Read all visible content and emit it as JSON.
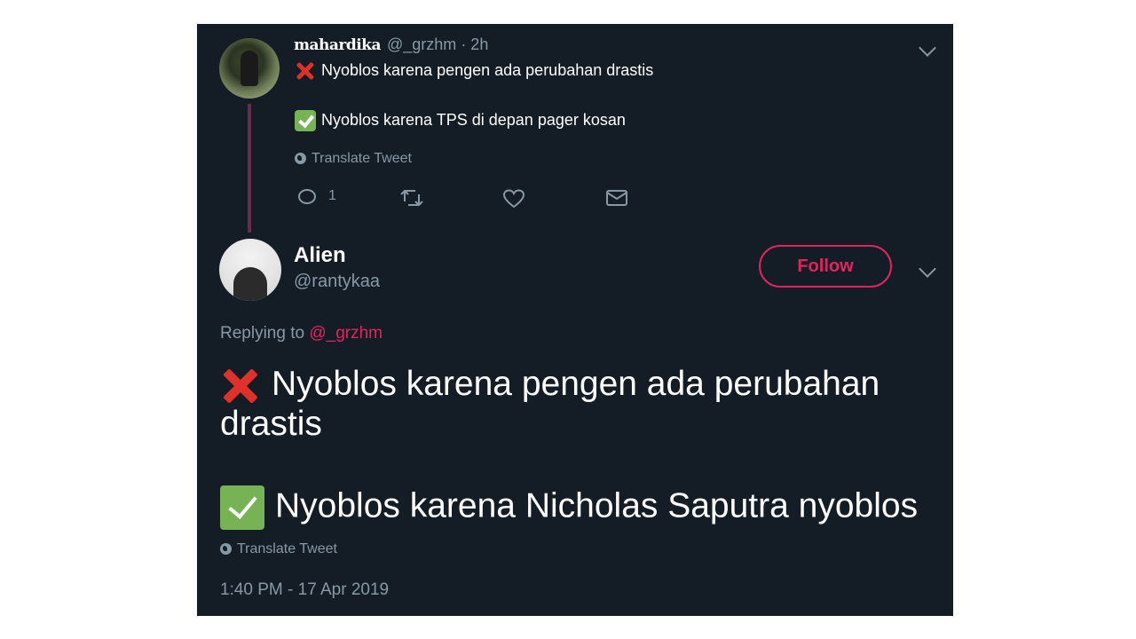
{
  "parent_tweet": {
    "display_name": "mahardika",
    "handle": "@_grzhm",
    "time": "· 2h",
    "line1": "Nyoblos karena pengen ada perubahan drastis",
    "line2": "Nyoblos karena TPS di depan pager kosan",
    "translate_label": "Translate Tweet",
    "reply_count": "1",
    "icons": [
      "reply-icon",
      "retweet-icon",
      "like-icon",
      "message-icon",
      "chevron-down-icon"
    ]
  },
  "reply_tweet": {
    "display_name": "Alien",
    "handle": "@rantykaa",
    "follow_label": "Follow",
    "replying_prefix": "Replying to",
    "replying_mention": "@_grzhm",
    "line1a": "Nyoblos karena pengen ada perubahan",
    "line1b": "drastis",
    "line2": "Nyoblos karena Nicholas Saputra nyoblos",
    "translate_label": "Translate Tweet",
    "timestamp": "1:40 PM - 17 Apr 2019"
  },
  "colors": {
    "background": "#141d26",
    "accent": "#e0245e",
    "muted": "#8899a6",
    "thread_line": "#6a2a4a"
  }
}
